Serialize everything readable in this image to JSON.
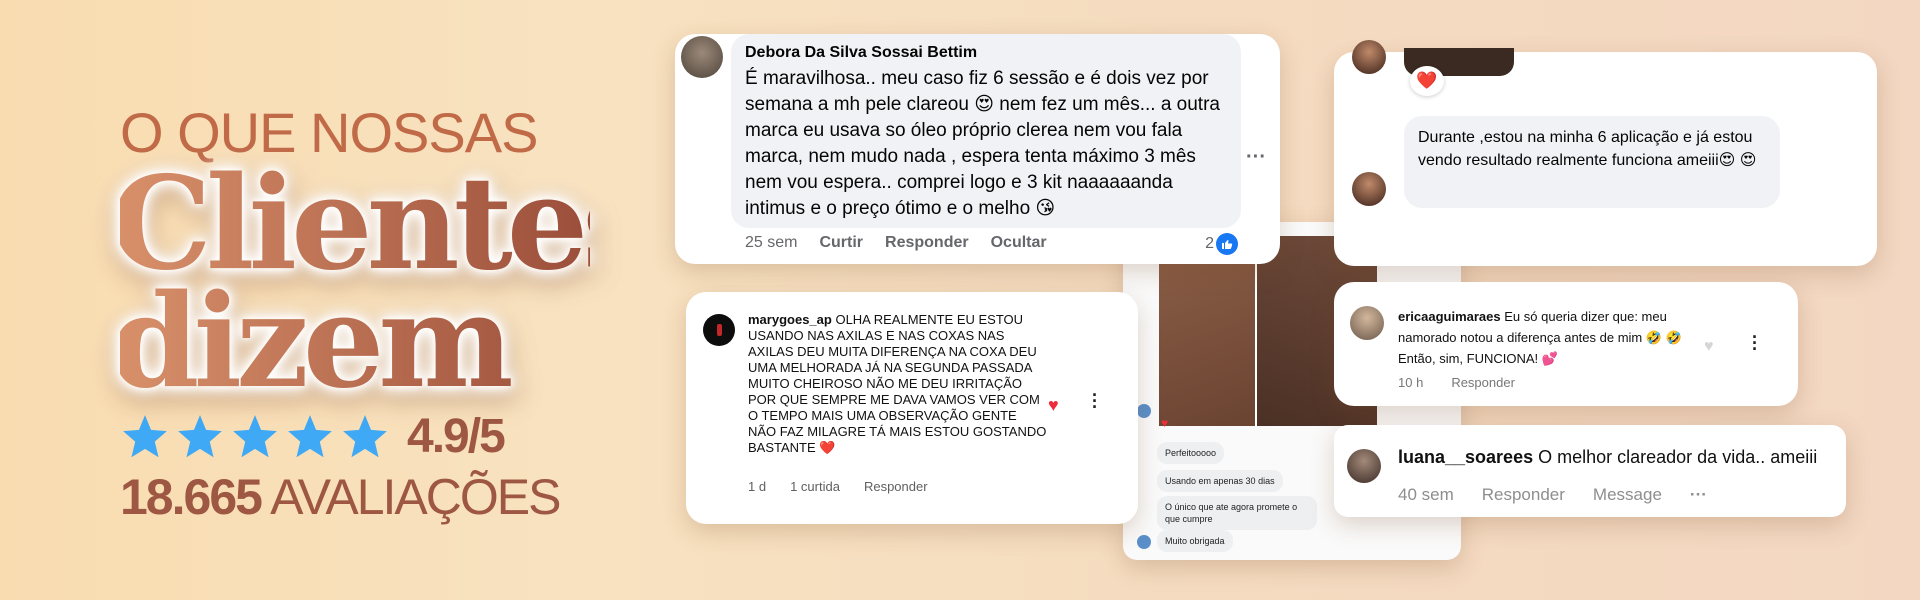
{
  "hero": {
    "pre_title": "O QUE NOSSAS",
    "title_line1": "Clientes",
    "title_line2": "dizem",
    "rating": "4.9/5",
    "stars": 5,
    "reviews_count": "18.665",
    "reviews_label": "AVALIAÇÕES"
  },
  "colors": {
    "accent": "#9d5742",
    "star": "#3fa9f5",
    "fb_like": "#1877f2",
    "heart": "#ed2d3c"
  },
  "card1": {
    "name": "Debora Da Silva Sossai Bettim",
    "text": "É maravilhosa.. meu caso fiz 6 sessão e é dois vez por semana a mh pele clareou 😍 nem fez um mês... a outra marca eu usava so óleo próprio clerea nem vou fala marca, nem mudo nada , espera tenta máximo 3 mês nem vou espera.. comprei logo e 3 kit naaaaaanda intimus e o preço ótimo e o melho 😘",
    "time": "25 sem",
    "like": "Curtir",
    "reply": "Responder",
    "hide": "Ocultar",
    "like_count": "2",
    "more": "···"
  },
  "card2": {
    "reaction": "❤️",
    "text": "Durante ,estou na minha 6 aplicação e já estou vendo resultado realmente funciona ameiii😍 😍"
  },
  "card3": {
    "username": "marygoes_ap",
    "text": "OLHA REALMENTE EU ESTOU USANDO NAS AXILAS E NAS COXAS NAS AXILAS DEU MUITA DIFERENÇA NA COXA DEU UMA MELHORADA JÁ NA SEGUNDA PASSADA MUITO CHEIROSO NÃO ME DEU IRRITAÇÃO POR QUE SEMPRE ME DAVA VAMOS VER COM O TEMPO MAIS UMA OBSERVAÇÃO GENTE NÃO FAZ MILAGRE TÁ MAIS ESTOU GOSTANDO BASTANTE ❤️",
    "time": "1 d",
    "likes": "1 curtida",
    "reply": "Responder"
  },
  "photo_card": {
    "messages": [
      "Perfeitooooo",
      "Usando em apenas 30 dias",
      "O único que ate agora promete o que cumpre",
      "Muito obrigada"
    ]
  },
  "card4": {
    "username": "ericaaguimaraes",
    "text": "Eu só queria dizer que: meu namorado notou a diferença antes de mim 🤣 🤣 Então, sim, FUNCIONA! 💕",
    "time": "10 h",
    "reply": "Responder"
  },
  "card5": {
    "username": "luana__soarees",
    "text": "O melhor clareador da vida.. ameiii",
    "time": "40 sem",
    "reply": "Responder",
    "message": "Message",
    "more": "···"
  }
}
